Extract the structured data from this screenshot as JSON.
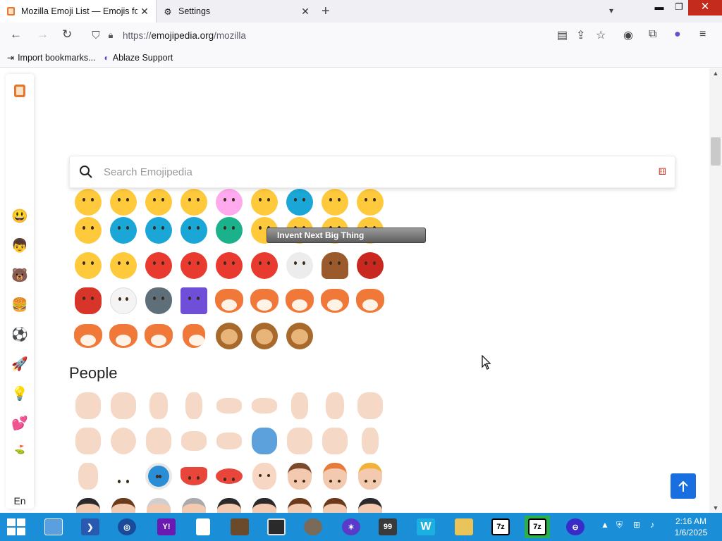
{
  "browser": {
    "tabs": [
      {
        "title": "Mozilla Emoji List — Emojis for Mozilla",
        "active": true
      },
      {
        "title": "Settings",
        "active": false
      }
    ],
    "url_prefix": "https://",
    "url_host": "emojipedia.org",
    "url_path": "/mozilla",
    "bookmarks": [
      {
        "label": "Import bookmarks...",
        "icon": "import-icon"
      },
      {
        "label": "Ablaze Support",
        "icon": "ablaze-icon"
      }
    ]
  },
  "page": {
    "search_placeholder": "Search Emojipedia",
    "section_title": "People",
    "tooltip": "Invent Next Big Thing",
    "sidebar_lang": "En",
    "sidebar_categories": [
      "smileys",
      "people",
      "animals",
      "food",
      "activities",
      "travel",
      "objects",
      "symbols",
      "flags"
    ]
  },
  "taskbar": {
    "time": "2:16 AM",
    "date": "1/6/2025"
  },
  "colors": {
    "accent": "#1a6fe0",
    "taskbar": "#1a8fd8",
    "close_button": "#c42b1c"
  }
}
